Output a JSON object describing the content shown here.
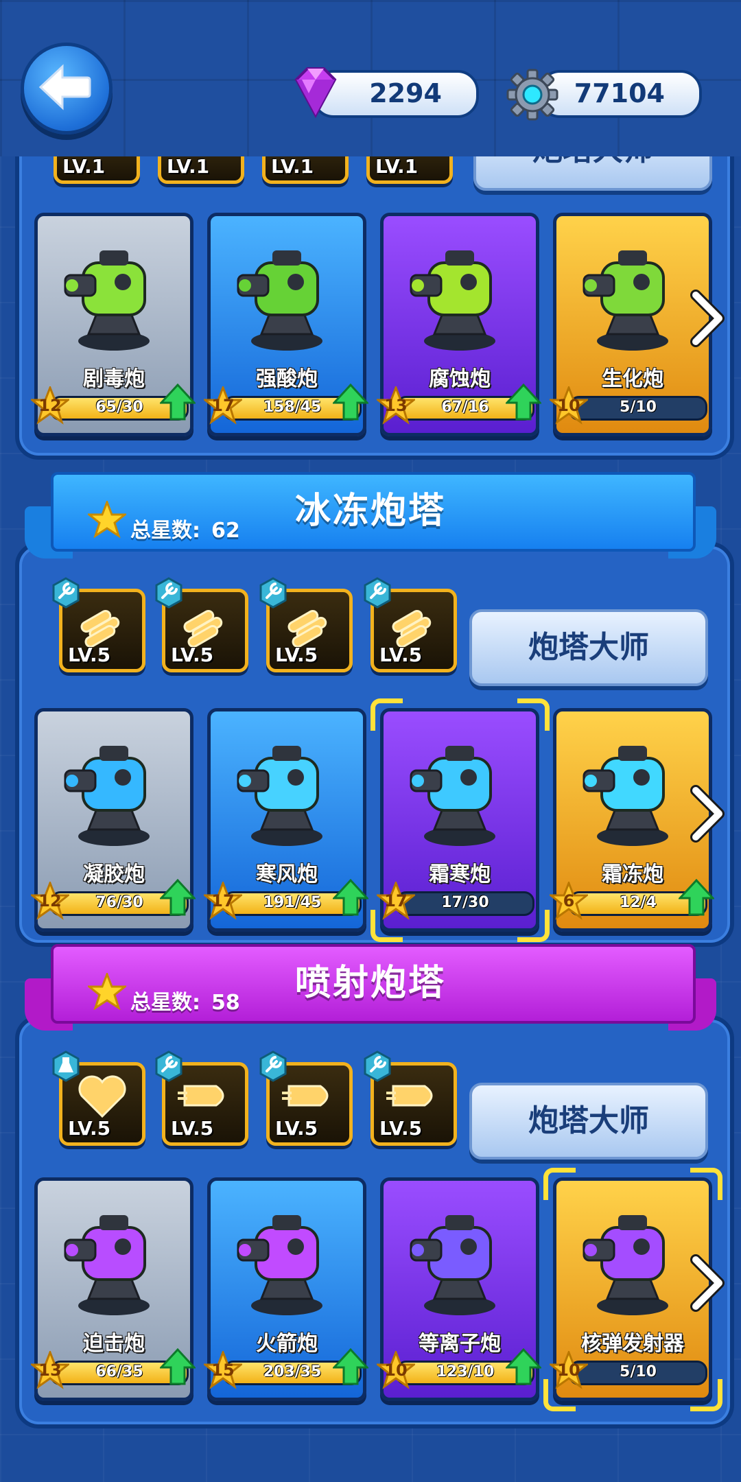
{
  "resources": {
    "gems": "2294",
    "gears": "77104"
  },
  "partial_section": {
    "skills": [
      "LV.1",
      "LV.1",
      "LV.1",
      "LV.1"
    ],
    "master": "炮塔大师",
    "towers": [
      {
        "name": "剧毒炮",
        "level": "12",
        "progress": "65/30",
        "fill": 1.0,
        "rarity": "grey",
        "upgrade": true,
        "color": "#8be23a"
      },
      {
        "name": "强酸炮",
        "level": "17",
        "progress": "158/45",
        "fill": 1.0,
        "rarity": "blue",
        "upgrade": true,
        "color": "#66d236"
      },
      {
        "name": "腐蚀炮",
        "level": "13",
        "progress": "67/16",
        "fill": 1.0,
        "rarity": "purple",
        "upgrade": true,
        "color": "#a4e52e"
      },
      {
        "name": "生化炮",
        "level": "10",
        "progress": "5/10",
        "fill": 0.0,
        "rarity": "gold",
        "upgrade": false,
        "color": "#7fd93a"
      }
    ]
  },
  "sections": [
    {
      "title": "冰冻炮塔",
      "stars_label": "总星数:",
      "stars": "62",
      "theme": "blue",
      "skills": [
        "LV.5",
        "LV.5",
        "LV.5",
        "LV.5"
      ],
      "skill_badges": [
        "wrench",
        "wrench",
        "wrench",
        "wrench"
      ],
      "master": "炮塔大师",
      "towers": [
        {
          "name": "凝胶炮",
          "level": "12",
          "progress": "76/30",
          "fill": 1.0,
          "rarity": "grey",
          "upgrade": true,
          "color": "#35b8ff"
        },
        {
          "name": "寒风炮",
          "level": "17",
          "progress": "191/45",
          "fill": 1.0,
          "rarity": "blue",
          "upgrade": true,
          "color": "#47d2ff"
        },
        {
          "name": "霜寒炮",
          "level": "17",
          "progress": "17/30",
          "fill": 0.0,
          "rarity": "purple",
          "upgrade": false,
          "selected": true,
          "color": "#3ec9ff"
        },
        {
          "name": "霜冻炮",
          "level": "6",
          "progress": "12/4",
          "fill": 1.0,
          "rarity": "gold",
          "upgrade": true,
          "color": "#41d8ff"
        }
      ]
    },
    {
      "title": "喷射炮塔",
      "stars_label": "总星数:",
      "stars": "58",
      "theme": "magenta",
      "skills": [
        "LV.5",
        "LV.5",
        "LV.5",
        "LV.5"
      ],
      "skill_badges": [
        "flask",
        "wrench",
        "wrench",
        "wrench"
      ],
      "master": "炮塔大师",
      "towers": [
        {
          "name": "迫击炮",
          "level": "13",
          "progress": "66/35",
          "fill": 1.0,
          "rarity": "grey",
          "upgrade": true,
          "color": "#b84dff"
        },
        {
          "name": "火箭炮",
          "level": "15",
          "progress": "203/35",
          "fill": 1.0,
          "rarity": "blue",
          "upgrade": true,
          "color": "#c14bff"
        },
        {
          "name": "等离子炮",
          "level": "10",
          "progress": "123/10",
          "fill": 1.0,
          "rarity": "purple",
          "upgrade": true,
          "color": "#7a5cff"
        },
        {
          "name": "核弹发射器",
          "level": "10",
          "progress": "5/10",
          "fill": 0.0,
          "rarity": "gold",
          "upgrade": false,
          "selected": true,
          "color": "#a44dff"
        }
      ]
    }
  ]
}
